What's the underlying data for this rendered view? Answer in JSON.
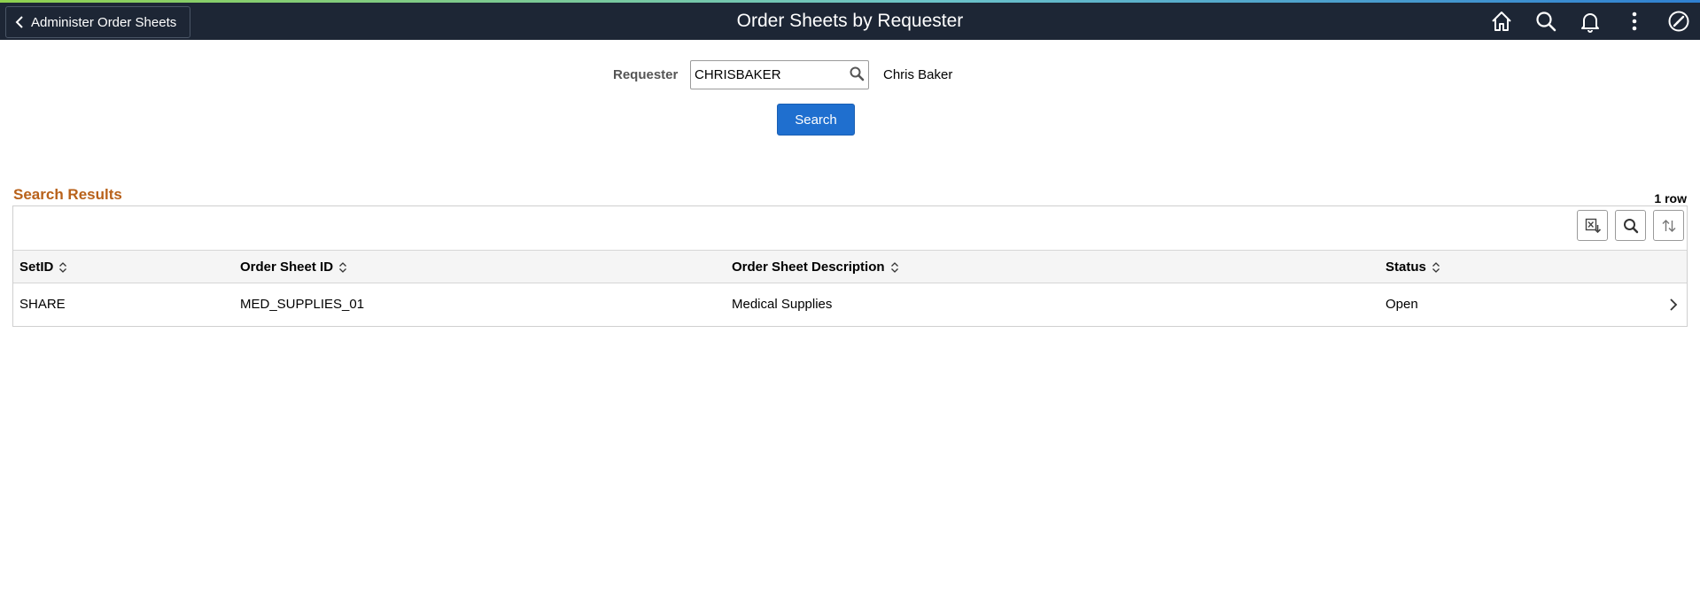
{
  "header": {
    "back_label": "Administer Order Sheets",
    "title": "Order Sheets by Requester",
    "icons": [
      "home-icon",
      "search-icon",
      "bell-icon",
      "more-icon",
      "compass-icon"
    ]
  },
  "criteria": {
    "requester_label": "Requester",
    "requester_value": "CHRISBAKER",
    "requester_name": "Chris Baker",
    "search_label": "Search"
  },
  "results": {
    "title": "Search Results",
    "row_count": "1 row",
    "columns": [
      "SetID",
      "Order Sheet ID",
      "Order Sheet Description",
      "Status"
    ],
    "rows": [
      {
        "setid": "SHARE",
        "order_sheet_id": "MED_SUPPLIES_01",
        "description": "Medical Supplies",
        "status": "Open"
      }
    ]
  },
  "colors": {
    "header_bg": "#1d2635",
    "primary_button": "#1f6fcf",
    "section_title": "#b8611a"
  }
}
